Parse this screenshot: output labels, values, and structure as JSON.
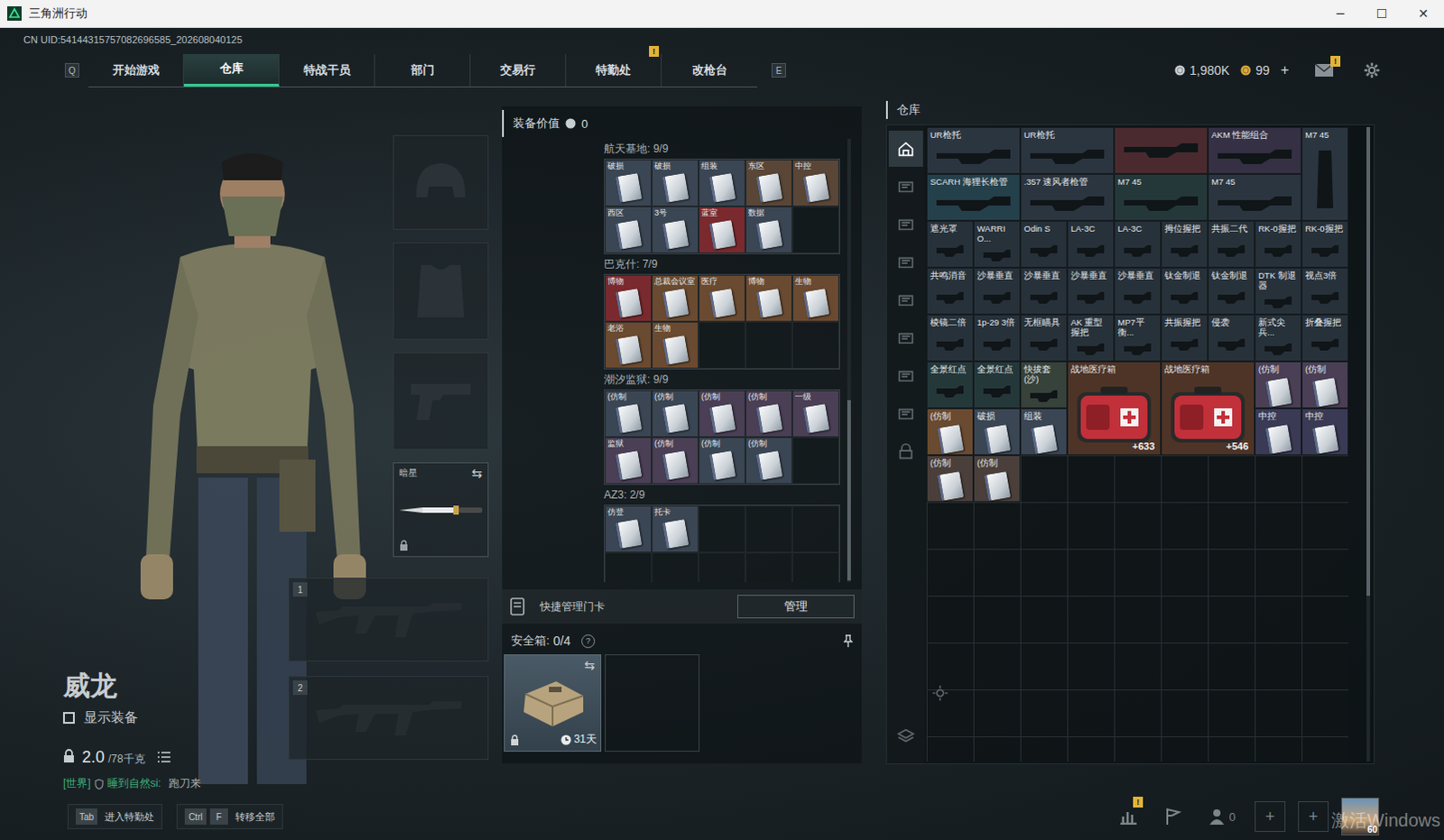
{
  "window": {
    "title": "三角洲行动",
    "controls": [
      "─",
      "☐",
      "✕"
    ]
  },
  "uid": "CN UID:54144315757082696585_202608040125",
  "nav": {
    "left_key": "Q",
    "right_key": "E",
    "tabs": [
      {
        "label": "开始游戏",
        "selected": false,
        "badge": ""
      },
      {
        "label": "仓库",
        "selected": true,
        "badge": ""
      },
      {
        "label": "特战干员",
        "selected": false,
        "badge": ""
      },
      {
        "label": "部门",
        "selected": false,
        "badge": ""
      },
      {
        "label": "交易行",
        "selected": false,
        "badge": ""
      },
      {
        "label": "特勤处",
        "selected": false,
        "badge": "!"
      },
      {
        "label": "改枪台",
        "selected": false,
        "badge": ""
      }
    ]
  },
  "currency": [
    {
      "value": "1,980K",
      "color": "#c9ced2"
    },
    {
      "value": "99",
      "color": "#d9a93a"
    }
  ],
  "currency_add": "+",
  "mail_badge": "!",
  "operator": {
    "name": "威龙",
    "show_gear": {
      "label": "显示装备",
      "checked": false
    },
    "weight": "2.0",
    "weight_max": "/78千克"
  },
  "chat": {
    "channel": "[世界]",
    "sender": "睡到自然si:",
    "message": "跑刀来"
  },
  "hints": [
    {
      "keys": [
        "Tab"
      ],
      "label": "进入特勤处"
    },
    {
      "keys": [
        "Ctrl",
        "F"
      ],
      "label": "转移全部"
    }
  ],
  "equipment": {
    "melee": {
      "label": "暗星",
      "swap": "⇆"
    },
    "weapon_slots": [
      "1",
      "2"
    ]
  },
  "loadout": {
    "value_label": "装备价值",
    "value": "0",
    "groups": [
      {
        "title": "航天基地: 9/9",
        "cards": [
          {
            "label": "破损",
            "color": "#3b4654"
          },
          {
            "label": "破损",
            "color": "#3b4654"
          },
          {
            "label": "组装",
            "color": "#3b4654"
          },
          {
            "label": "东区",
            "color": "#5a4636"
          },
          {
            "label": "中控",
            "color": "#5a4636"
          },
          {
            "label": "西区",
            "color": "#3b4654"
          },
          {
            "label": "3号",
            "color": "#3b4654"
          },
          {
            "label": "蓝室",
            "color": "#7a2a2e"
          },
          {
            "label": "数据",
            "color": "#3b4654"
          }
        ]
      },
      {
        "title": "巴克什: 7/9",
        "cards": [
          {
            "label": "博物",
            "color": "#7a2a2e"
          },
          {
            "label": "总裁会议室",
            "color": "#6a4a30"
          },
          {
            "label": "医疗",
            "color": "#6a4a30"
          },
          {
            "label": "博物",
            "color": "#6a4a30"
          },
          {
            "label": "生物",
            "color": "#6a4a30"
          },
          {
            "label": "老浴",
            "color": "#6a4a30"
          },
          {
            "label": "生物",
            "color": "#6a4a30"
          }
        ]
      },
      {
        "title": "潮汐监狱: 9/9",
        "cards": [
          {
            "label": "(仿制",
            "color": "#3b4654"
          },
          {
            "label": "(仿制",
            "color": "#3b4654"
          },
          {
            "label": "(仿制",
            "color": "#4a3f55"
          },
          {
            "label": "(仿制",
            "color": "#4a3f55"
          },
          {
            "label": "一级",
            "color": "#4a3f55"
          },
          {
            "label": "监狱",
            "color": "#4a3f55"
          },
          {
            "label": "(仿制",
            "color": "#4a3f55"
          },
          {
            "label": "(仿制",
            "color": "#3b4654"
          },
          {
            "label": "(仿制",
            "color": "#3b4654"
          }
        ]
      },
      {
        "title": "AZ3: 2/9",
        "cards": [
          {
            "label": "仿登",
            "color": "#3b4654"
          },
          {
            "label": "托卡",
            "color": "#3b4654"
          }
        ]
      }
    ],
    "quick_manage": "快捷管理门卡",
    "manage_button": "管理",
    "safe_box": {
      "label": "安全箱:",
      "count": "0/4",
      "help": "?",
      "swap": "⇆",
      "time": "31天"
    }
  },
  "warehouse": {
    "title": "仓库",
    "sidebar": [
      {
        "selected": true
      },
      {
        "selected": false
      },
      {
        "selected": false
      },
      {
        "selected": false
      },
      {
        "selected": false
      },
      {
        "selected": false
      },
      {
        "selected": false
      },
      {
        "selected": false
      },
      {
        "selected": false
      },
      {
        "selected": false
      },
      {
        "selected": false
      }
    ],
    "items": [
      {
        "label": "UR枪托",
        "kind": "long",
        "color": "#2b3540",
        "value": ""
      },
      {
        "label": "UR枪托",
        "kind": "long",
        "color": "#2b3540",
        "value": ""
      },
      {
        "label": "",
        "kind": "long",
        "color": "#4a2a2e",
        "value": ""
      },
      {
        "label": "AKM 性能组合",
        "kind": "long",
        "color": "#353044",
        "value": ""
      },
      {
        "label": "M7 45",
        "kind": "tall",
        "color": "#2b3540",
        "value": ""
      },
      {
        "label": "SCARH 海狸长枪管",
        "kind": "long",
        "color": "#24404a",
        "value": ""
      },
      {
        "label": ".357 速风者枪管",
        "kind": "long",
        "color": "#2b3540",
        "value": ""
      },
      {
        "label": "M7 45",
        "kind": "long",
        "color": "#24383a",
        "value": ""
      },
      {
        "label": "M7 45",
        "kind": "long",
        "color": "#2b3540",
        "value": ""
      },
      {
        "label": "遮光罩",
        "kind": "part",
        "color": "#27313a",
        "value": ""
      },
      {
        "label": "WARRIO...",
        "kind": "part",
        "color": "#27313a",
        "value": ""
      },
      {
        "label": "Odin S",
        "kind": "part",
        "color": "#27313a",
        "value": ""
      },
      {
        "label": "LA-3C",
        "kind": "part",
        "color": "#27313a",
        "value": ""
      },
      {
        "label": "LA-3C",
        "kind": "part",
        "color": "#27313a",
        "value": ""
      },
      {
        "label": "拇位握把",
        "kind": "part",
        "color": "#27313a",
        "value": ""
      },
      {
        "label": "共振二代",
        "kind": "part",
        "color": "#27313a",
        "value": ""
      },
      {
        "label": "RK-0握把",
        "kind": "part",
        "color": "#27313a",
        "value": ""
      },
      {
        "label": "RK-0握把",
        "kind": "part",
        "color": "#27313a",
        "value": ""
      },
      {
        "label": "共鸣消音",
        "kind": "part",
        "color": "#27313a",
        "value": ""
      },
      {
        "label": "沙暴垂直",
        "kind": "part",
        "color": "#27313a",
        "value": ""
      },
      {
        "label": "沙暴垂直",
        "kind": "part",
        "color": "#27313a",
        "value": ""
      },
      {
        "label": "沙暴垂直",
        "kind": "part",
        "color": "#27313a",
        "value": ""
      },
      {
        "label": "沙暴垂直",
        "kind": "part",
        "color": "#27313a",
        "value": ""
      },
      {
        "label": "钛金制退",
        "kind": "part",
        "color": "#27313a",
        "value": ""
      },
      {
        "label": "钛金制退",
        "kind": "part",
        "color": "#27313a",
        "value": ""
      },
      {
        "label": "DTK 制退器",
        "kind": "part",
        "color": "#27313a",
        "value": ""
      },
      {
        "label": "视点3倍",
        "kind": "part",
        "color": "#27313a",
        "value": ""
      },
      {
        "label": "棱镜二倍",
        "kind": "part",
        "color": "#27313a",
        "value": ""
      },
      {
        "label": "1p-29 3倍",
        "kind": "part",
        "color": "#27313a",
        "value": ""
      },
      {
        "label": "无框瞄具",
        "kind": "part",
        "color": "#27313a",
        "value": ""
      },
      {
        "label": "AK 重型握把",
        "kind": "part",
        "color": "#27313a",
        "value": ""
      },
      {
        "label": "MP7平衡...",
        "kind": "part",
        "color": "#27313a",
        "value": ""
      },
      {
        "label": "共振握把",
        "kind": "part",
        "color": "#27313a",
        "value": ""
      },
      {
        "label": "侵袭",
        "kind": "part",
        "color": "#27313a",
        "value": ""
      },
      {
        "label": "新式尖兵...",
        "kind": "part",
        "color": "#27313a",
        "value": ""
      },
      {
        "label": "折叠握把",
        "kind": "part",
        "color": "#27313a",
        "value": ""
      },
      {
        "label": "全景红点",
        "kind": "part",
        "color": "#24383a",
        "value": ""
      },
      {
        "label": "全景红点",
        "kind": "part",
        "color": "#24383a",
        "value": ""
      },
      {
        "label": "快拔套(沙)",
        "kind": "part",
        "color": "#36423a",
        "value": ""
      },
      {
        "label": "战地医疗箱",
        "kind": "medkit",
        "color": "#4e3426",
        "value": "+633"
      },
      {
        "label": "战地医疗箱",
        "kind": "medkit",
        "color": "#4e3426",
        "value": "+546"
      },
      {
        "label": "(仿制",
        "kind": "card",
        "color": "#4a3f55",
        "value": ""
      },
      {
        "label": "(仿制",
        "kind": "card",
        "color": "#4a3f55",
        "value": ""
      },
      {
        "label": "(仿制",
        "kind": "card",
        "color": "#6a4a30",
        "value": ""
      },
      {
        "label": "破损",
        "kind": "card",
        "color": "#3b4654",
        "value": ""
      },
      {
        "label": "组装",
        "kind": "card",
        "color": "#3b4654",
        "value": ""
      },
      {
        "label": "中控",
        "kind": "card",
        "color": "#3a3a55",
        "value": ""
      },
      {
        "label": "中控",
        "kind": "card",
        "color": "#3a3a55",
        "value": ""
      },
      {
        "label": "(仿制",
        "kind": "card",
        "color": "#4a3f3a",
        "value": ""
      },
      {
        "label": "(仿制",
        "kind": "card",
        "color": "#4a3f3a",
        "value": ""
      }
    ]
  },
  "bottom_bar": {
    "stats_badge": "!",
    "friends": "0",
    "plus": [
      "+",
      "+"
    ],
    "avatar_level": "60",
    "watermark": "激活Windows"
  }
}
